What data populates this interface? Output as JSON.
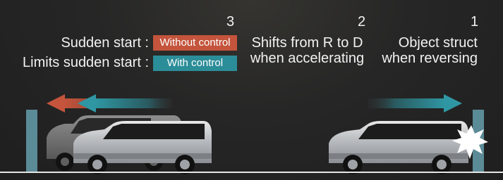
{
  "steps": {
    "three": "3",
    "two": "2",
    "one": "1"
  },
  "legend": {
    "without_prefix": "Sudden start :",
    "without_label": "Without control",
    "with_prefix": "Limits sudden start :",
    "with_label": "With control"
  },
  "captions": {
    "shift_line1": "Shifts from R to D",
    "shift_line2": "when accelerating",
    "object_line1": "Object struct",
    "object_line2": "when reversing"
  },
  "colors": {
    "without_control": "#c4543c",
    "with_control": "#2b8d98",
    "wall": "#5b8b96",
    "ground": "#e6e6e6",
    "impact": "#ffffff"
  },
  "icons": [
    "wall-post",
    "van",
    "arrow-left",
    "arrow-right",
    "impact-burst"
  ]
}
